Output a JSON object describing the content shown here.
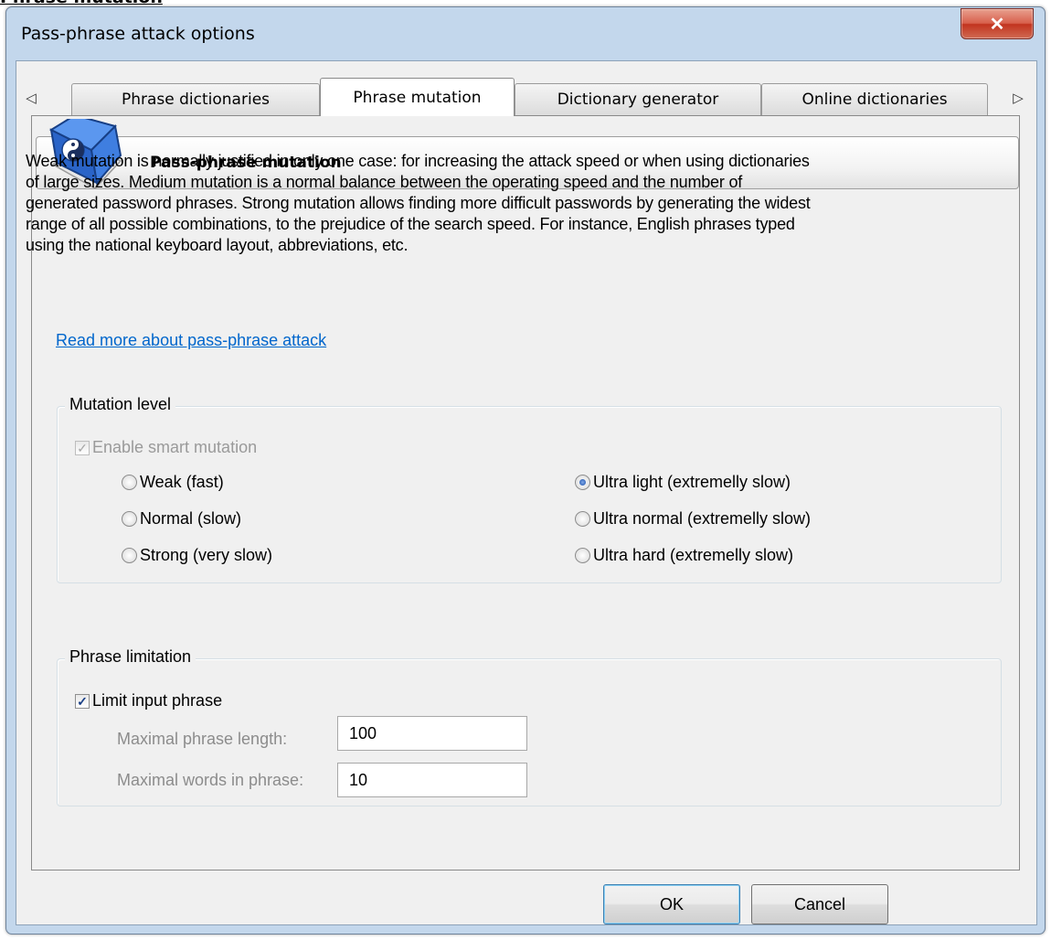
{
  "doc_heading": "Phrase mutation",
  "window": {
    "title": "Pass-phrase attack options",
    "close_glyph": "✕"
  },
  "tabs": {
    "scroll_left": "◁",
    "scroll_right": "▷",
    "items": [
      {
        "label": "Phrase dictionaries",
        "active": false
      },
      {
        "label": "Phrase mutation",
        "active": true
      },
      {
        "label": "Dictionary generator",
        "active": false
      },
      {
        "label": "Online dictionaries",
        "active": false
      }
    ]
  },
  "banner": {
    "icon": "yin-yang-book-icon",
    "title": "Pass-phrase mutation"
  },
  "description": {
    "lines": [
      "Weak mutation is normally justified in only one case: for increasing the attack speed or when using dictionaries",
      "of large sizes. Medium mutation is a normal balance between the operating speed and the number of",
      "generated password phrases. Strong mutation allows finding more difficult passwords by generating the widest",
      "range of all possible combinations, to the prejudice of the search speed. For instance, English phrases typed",
      "using the national keyboard layout, abbreviations, etc."
    ],
    "link": "Read more about pass-phrase attack"
  },
  "mutation_level": {
    "caption": "Mutation level",
    "smart_mutation": {
      "label": "Enable smart mutation",
      "checked": true,
      "enabled": false
    },
    "options": [
      {
        "label": "Weak (fast)",
        "selected": false
      },
      {
        "label": "Normal (slow)",
        "selected": false
      },
      {
        "label": "Strong (very slow)",
        "selected": false
      },
      {
        "label": "Ultra light (extremelly slow)",
        "selected": true
      },
      {
        "label": "Ultra normal (extremelly slow)",
        "selected": false
      },
      {
        "label": "Ultra hard (extremelly slow)",
        "selected": false
      }
    ]
  },
  "phrase_limitation": {
    "caption": "Phrase limitation",
    "limit_input": {
      "label": "Limit input phrase",
      "checked": true
    },
    "max_length": {
      "label": "Maximal phrase length:",
      "value": "100"
    },
    "max_words": {
      "label": "Maximal words in phrase:",
      "value": "10"
    }
  },
  "buttons": {
    "ok": "OK",
    "cancel": "Cancel"
  },
  "colors": {
    "frame": "#c3d7ec",
    "client": "#f0f0f0",
    "link": "#0066cc",
    "close": "#c2341f"
  }
}
